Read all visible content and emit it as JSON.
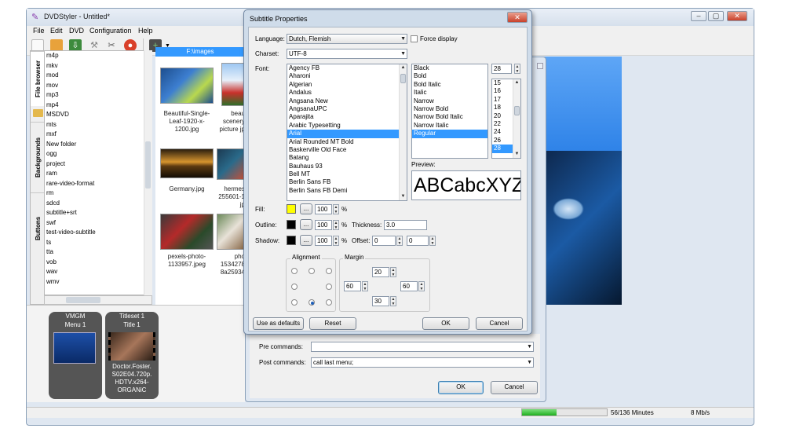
{
  "app": {
    "title": "DVDStyler - Untitled*",
    "menu": [
      "File",
      "Edit",
      "DVD",
      "Configuration",
      "Help"
    ],
    "win_controls": [
      "–",
      "▢",
      "✕"
    ]
  },
  "side_tabs": [
    "File browser",
    "Backgrounds",
    "Buttons"
  ],
  "file_list": [
    "m4p",
    "mkv",
    "mod",
    "mov",
    "mp3",
    "mp4",
    "MSDVD",
    "mts",
    "mxf",
    "New folder",
    "ogg",
    "project",
    "ram",
    "rare-video-format",
    "rm",
    "sdcd",
    "subtitle+srt",
    "swf",
    "test-video-subtitle",
    "ts",
    "tta",
    "vob",
    "wav",
    "wmv"
  ],
  "thumbs": {
    "path": "F:\\images",
    "items": [
      {
        "caption": "Beautiful-Single-Leaf-1920-x-1200.jpg"
      },
      {
        "caption": "beau scenery picture jp"
      },
      {
        "caption": "Germany.jpg"
      },
      {
        "caption": "hermes 255601-1 jp"
      },
      {
        "caption": "pexels-photo-1133957.jpeg"
      },
      {
        "caption": "pho 1534278 8a25934"
      }
    ]
  },
  "titlesets": [
    {
      "header": "VMGM",
      "label": "Menu 1"
    },
    {
      "header": "Titleset 1",
      "label": "Title 1",
      "caption": "Doctor.Foster. S02E04.720p. HDTV.x264- ORGANiC"
    }
  ],
  "status": {
    "size": "56/136 Minutes",
    "rate": "8 Mb/s",
    "progress": 0.41
  },
  "behind_dialog": {
    "pre_label": "Pre commands:",
    "pre_value": "",
    "post_label": "Post commands:",
    "post_value": "call last menu;",
    "ok": "OK",
    "cancel": "Cancel"
  },
  "dialog": {
    "title": "Subtitle Properties",
    "language_label": "Language:",
    "language_value": "Dutch, Flemish",
    "force_display": "Force display",
    "charset_label": "Charset:",
    "charset_value": "UTF-8",
    "font_label": "Font:",
    "fonts": [
      "Agency FB",
      "Aharoni",
      "Algerian",
      "Andalus",
      "Angsana New",
      "AngsanaUPC",
      "Aparajita",
      "Arabic Typesetting",
      "Arial",
      "Arial Rounded MT Bold",
      "Baskerville Old Face",
      "Batang",
      "Bauhaus 93",
      "Bell MT",
      "Berlin Sans FB",
      "Berlin Sans FB Demi"
    ],
    "font_selected": "Arial",
    "styles": [
      "Black",
      "Bold",
      "Bold Italic",
      "Italic",
      "Narrow",
      "Narrow Bold",
      "Narrow Bold Italic",
      "Narrow Italic",
      "Regular"
    ],
    "style_selected": "Regular",
    "size_value": "28",
    "sizes": [
      "15",
      "16",
      "17",
      "18",
      "20",
      "22",
      "24",
      "26",
      "28"
    ],
    "size_selected": "28",
    "preview_label": "Preview:",
    "preview_text": "ABCabcXYZ",
    "fill_label": "Fill:",
    "fill_color": "#ffff00",
    "fill_opacity": "100",
    "outline_label": "Outline:",
    "outline_color": "#000000",
    "outline_opacity": "100",
    "thickness_label": "Thickness:",
    "thickness_value": "3.0",
    "shadow_label": "Shadow:",
    "shadow_color": "#000000",
    "shadow_opacity": "100",
    "offset_label": "Offset:",
    "offset_x": "0",
    "offset_y": "0",
    "percent": "%",
    "dots": "...",
    "alignment_label": "Alignment",
    "margin_label": "Margin",
    "margin_top": "20",
    "margin_left": "60",
    "margin_right": "60",
    "margin_bottom": "30",
    "use_defaults": "Use as defaults",
    "reset": "Reset",
    "ok": "OK",
    "cancel": "Cancel",
    "close": "✕"
  }
}
